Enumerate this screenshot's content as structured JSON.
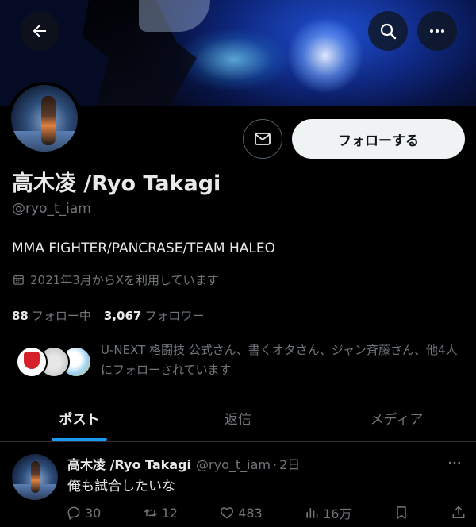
{
  "profile": {
    "name": "高木凌 /Ryo Takagi",
    "handle": "@ryo_t_iam",
    "bio": "MMA FIGHTER/PANCRASE/TEAM HALEO",
    "joined": "2021年3月からXを利用しています",
    "following_count": "88",
    "following_label": "フォロー中",
    "followers_count": "3,067",
    "followers_label": "フォロワー",
    "followed_by": "U-NEXT 格闘技 公式さん、書くオタさん、ジャン斉藤さん、他4人にフォローされています"
  },
  "actions": {
    "follow_label": "フォローする"
  },
  "icons": {
    "back": "back-arrow-icon",
    "search": "search-icon",
    "more": "more-icon",
    "mail": "mail-icon",
    "calendar": "calendar-icon"
  },
  "tabs": [
    {
      "label": "ポスト",
      "active": true
    },
    {
      "label": "返信",
      "active": false
    },
    {
      "label": "メディア",
      "active": false
    }
  ],
  "post": {
    "name": "高木凌 /Ryo Takagi",
    "handle": "@ryo_t_iam",
    "separator": "·",
    "time": "2日",
    "text": "俺も試合したいな",
    "replies": "30",
    "reposts": "12",
    "likes": "483",
    "views": "16万"
  },
  "colors": {
    "background": "#000000",
    "text": "#e7e9ea",
    "muted": "#71767b",
    "accent": "#1d9bf0"
  }
}
